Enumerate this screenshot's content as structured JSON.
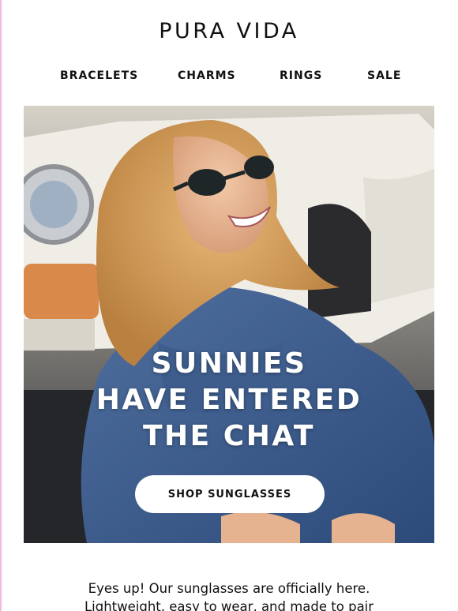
{
  "brand": {
    "logo_text": "PURA VIDA"
  },
  "nav": {
    "items": [
      {
        "label": "BRACELETS"
      },
      {
        "label": "CHARMS"
      },
      {
        "label": "RINGS"
      },
      {
        "label": "SALE"
      }
    ]
  },
  "hero": {
    "headline_lines": [
      "SUNNIES",
      "HAVE ENTERED",
      "THE CHAT"
    ],
    "cta_label": "SHOP SUNGLASSES"
  },
  "body": {
    "lines": [
      "Eyes up! Our sunglasses are officially here.",
      "Lightweight, easy to wear, and made to pair"
    ]
  },
  "colors": {
    "accent_border": "#f1b9e4",
    "text": "#111111",
    "cta_background": "#ffffff"
  }
}
